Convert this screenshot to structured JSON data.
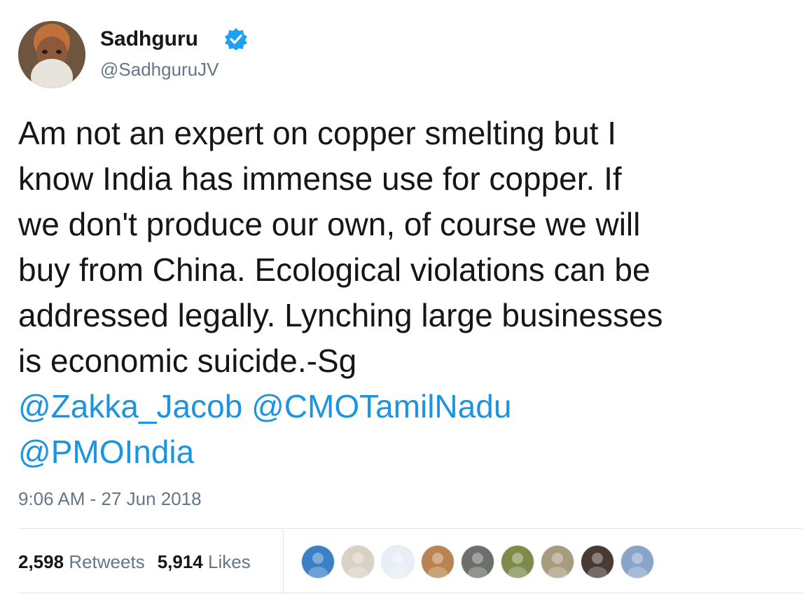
{
  "author": {
    "display_name": "Sadhguru",
    "handle": "@SadhguruJV",
    "verified": true,
    "avatar_icon": "profile-photo-avatar",
    "verified_icon": "verified-badge-icon"
  },
  "tweet": {
    "lines": [
      "Am not an expert on copper smelting but I",
      "know India has immense use for copper. If",
      "we don't produce our own, of course we will",
      "buy from China. Ecological violations can be",
      "addressed legally. Lynching large businesses",
      "is economic suicide.-Sg"
    ],
    "mentions": [
      "@Zakka_Jacob",
      "@CMOTamilNadu",
      "@PMOIndia"
    ],
    "timestamp": "9:06 AM - 27 Jun 2018"
  },
  "stats": {
    "retweets_count": "2,598",
    "retweets_label": "Retweets",
    "likes_count": "5,914",
    "likes_label": "Likes"
  },
  "liker_avatars": [
    {
      "icon": "user-avatar",
      "color": "#3b7fc4"
    },
    {
      "icon": "note-image-avatar",
      "color": "#d8d2c4"
    },
    {
      "icon": "tiger-logo-avatar",
      "color": "#e8eef5"
    },
    {
      "icon": "user-avatar",
      "color": "#b9844f"
    },
    {
      "icon": "user-avatar",
      "color": "#6d6f6a"
    },
    {
      "icon": "user-avatar",
      "color": "#7d8a4a"
    },
    {
      "icon": "user-avatar",
      "color": "#a89a7c"
    },
    {
      "icon": "user-avatar",
      "color": "#4a3a34"
    },
    {
      "icon": "user-avatar",
      "color": "#8aa4c8"
    }
  ],
  "colors": {
    "text": "#14171a",
    "secondary": "#657786",
    "link": "#1b95e0",
    "verified": "#1da1f2",
    "divider": "#e1e8ed"
  }
}
